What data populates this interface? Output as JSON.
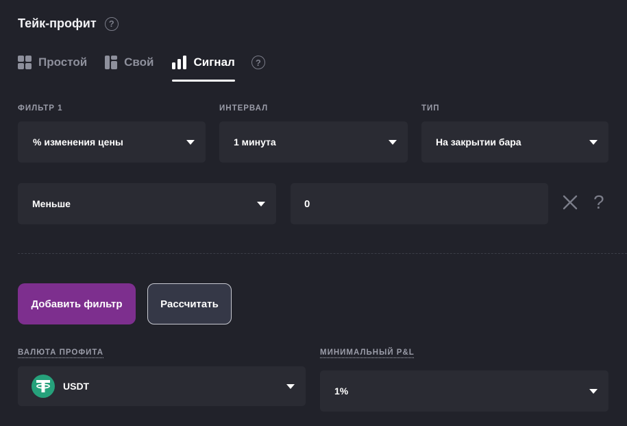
{
  "header": {
    "title": "Тейк-профит"
  },
  "tabs": [
    {
      "label": "Простой",
      "icon": "grid-icon",
      "active": false
    },
    {
      "label": "Свой",
      "icon": "layout-icon",
      "active": false
    },
    {
      "label": "Сигнал",
      "icon": "bar-chart-icon",
      "active": true
    }
  ],
  "filter": {
    "filter_label": "ФИЛЬТР 1",
    "interval_label": "ИНТЕРВАЛ",
    "type_label": "ТИП",
    "filter_value": "% изменения цены",
    "interval_value": "1 минута",
    "type_value": "На закрытии бара",
    "comparison_value": "Меньше",
    "threshold_value": "0",
    "remove_icon": "close-icon",
    "help_glyph": "?"
  },
  "actions": {
    "add_filter_label": "Добавить фильтр",
    "calculate_label": "Рассчитать"
  },
  "profit": {
    "currency_label": "ВАЛЮТА ПРОФИТА",
    "currency_value": "USDT",
    "currency_icon": "tether-icon",
    "min_pnl_label": "МИНИМАЛЬНЫЙ P&L",
    "min_pnl_value": "1%"
  },
  "colors": {
    "background": "#21222a",
    "field": "#2a2b33",
    "primary_button": "#7d2f8e",
    "tether": "#26a17b"
  }
}
